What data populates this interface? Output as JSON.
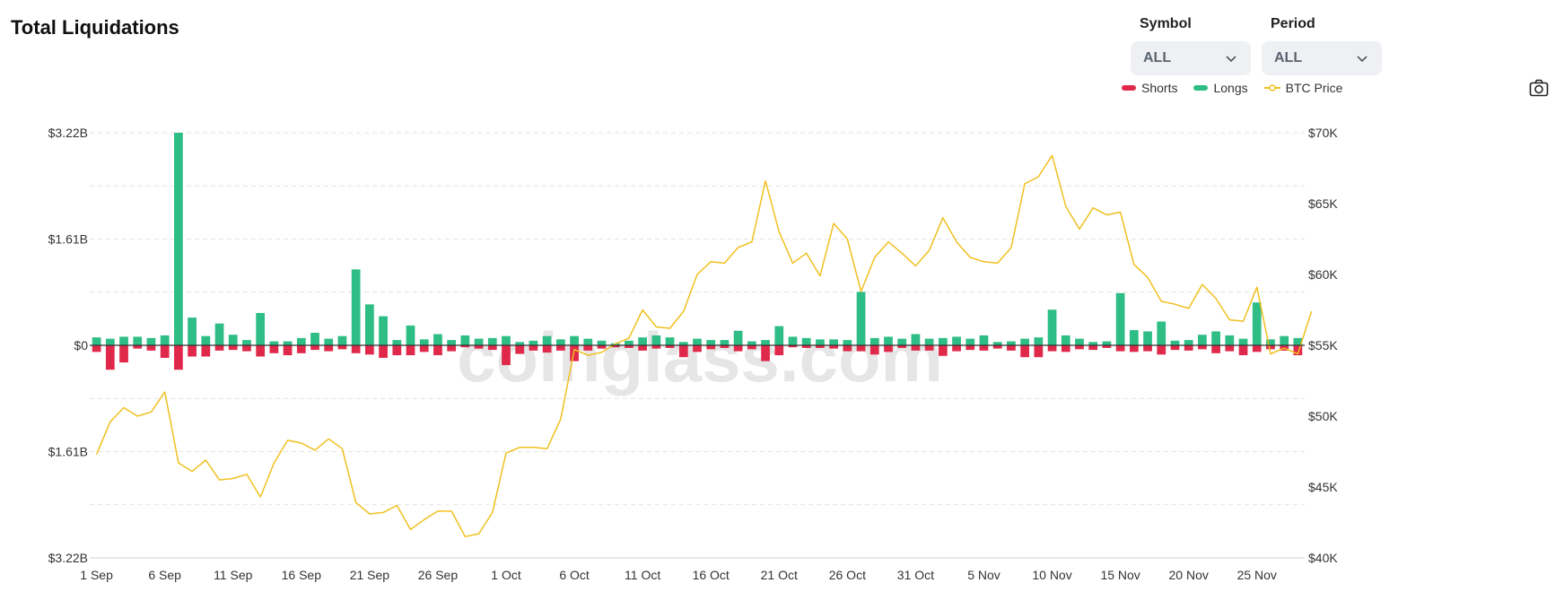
{
  "header": {
    "title": "Total Liquidations"
  },
  "controls": {
    "symbol_label": "Symbol",
    "symbol_value": "ALL",
    "period_label": "Period",
    "period_value": "ALL"
  },
  "legend": [
    {
      "name": "Shorts",
      "color": "#e0294a"
    },
    {
      "name": "Longs",
      "color": "#2dbd85"
    },
    {
      "name": "BTC Price",
      "color": "#f0c020"
    }
  ],
  "watermark": "coinglass.com",
  "icons": {
    "camera": "camera-icon",
    "chevron": "chevron-down-icon"
  },
  "chart_data": {
    "type": "bar",
    "title": "Total Liquidations",
    "x_tick_labels": [
      "1 Sep",
      "6 Sep",
      "11 Sep",
      "16 Sep",
      "21 Sep",
      "26 Sep",
      "1 Oct",
      "6 Oct",
      "11 Oct",
      "16 Oct",
      "21 Oct",
      "26 Oct",
      "31 Oct",
      "5 Nov",
      "10 Nov",
      "15 Nov",
      "20 Nov",
      "25 Nov"
    ],
    "left_axis_labels": [
      "$3.22B",
      "$1.61B",
      "$0",
      "$1.61B",
      "$3.22B"
    ],
    "left_axis_values": [
      3.22,
      1.61,
      0,
      -1.61,
      -3.22
    ],
    "right_axis_labels": [
      "$70K",
      "$65K",
      "$60K",
      "$55K",
      "$50K",
      "$45K",
      "$40K"
    ],
    "right_axis_values": [
      70000,
      65000,
      60000,
      55000,
      50000,
      45000,
      40000
    ],
    "ylim_left": [
      -3.22,
      3.22
    ],
    "ylim_right": [
      40000,
      70000
    ],
    "grid": true,
    "legend_position": "top-right",
    "series": [
      {
        "name": "Longs",
        "type": "bar",
        "color": "#2dbd85",
        "unit": "$B",
        "values": [
          0.12,
          0.1,
          0.13,
          0.13,
          0.11,
          0.15,
          3.22,
          0.42,
          0.14,
          0.33,
          0.16,
          0.08,
          0.49,
          0.06,
          0.06,
          0.11,
          0.19,
          0.1,
          0.14,
          1.15,
          0.62,
          0.44,
          0.08,
          0.3,
          0.09,
          0.17,
          0.08,
          0.15,
          0.1,
          0.11,
          0.14,
          0.05,
          0.07,
          0.14,
          0.09,
          0.14,
          0.1,
          0.07,
          0.03,
          0.07,
          0.12,
          0.15,
          0.12,
          0.05,
          0.1,
          0.08,
          0.08,
          0.22,
          0.06,
          0.08,
          0.29,
          0.13,
          0.11,
          0.09,
          0.09,
          0.08,
          0.81,
          0.11,
          0.13,
          0.1,
          0.17,
          0.1,
          0.11,
          0.13,
          0.1,
          0.15,
          0.05,
          0.06,
          0.1,
          0.12,
          0.54,
          0.15,
          0.1,
          0.05,
          0.06,
          0.79,
          0.23,
          0.21,
          0.36,
          0.07,
          0.08,
          0.16,
          0.21,
          0.15,
          0.1,
          0.65,
          0.09,
          0.14,
          0.11
        ]
      },
      {
        "name": "Shorts",
        "type": "bar",
        "color": "#e0294a",
        "unit": "$B",
        "values": [
          -0.1,
          -0.37,
          -0.26,
          -0.05,
          -0.08,
          -0.19,
          -0.37,
          -0.17,
          -0.17,
          -0.08,
          -0.07,
          -0.09,
          -0.17,
          -0.12,
          -0.15,
          -0.12,
          -0.07,
          -0.09,
          -0.06,
          -0.12,
          -0.14,
          -0.19,
          -0.15,
          -0.15,
          -0.1,
          -0.15,
          -0.09,
          -0.03,
          -0.05,
          -0.07,
          -0.3,
          -0.13,
          -0.08,
          -0.11,
          -0.08,
          -0.24,
          -0.08,
          -0.05,
          -0.03,
          -0.04,
          -0.08,
          -0.05,
          -0.04,
          -0.18,
          -0.1,
          -0.06,
          -0.04,
          -0.09,
          -0.06,
          -0.24,
          -0.15,
          -0.03,
          -0.04,
          -0.04,
          -0.05,
          -0.09,
          -0.09,
          -0.14,
          -0.1,
          -0.04,
          -0.08,
          -0.08,
          -0.16,
          -0.09,
          -0.07,
          -0.08,
          -0.05,
          -0.08,
          -0.18,
          -0.18,
          -0.09,
          -0.1,
          -0.06,
          -0.07,
          -0.04,
          -0.09,
          -0.1,
          -0.09,
          -0.14,
          -0.07,
          -0.08,
          -0.06,
          -0.12,
          -0.09,
          -0.15,
          -0.1,
          -0.06,
          -0.08,
          -0.15
        ]
      },
      {
        "name": "BTC Price",
        "type": "line",
        "color": "#f0c020",
        "unit": "USD",
        "values": [
          47300,
          49600,
          50600,
          50000,
          50300,
          51700,
          46700,
          46100,
          46900,
          45500,
          45600,
          45900,
          44300,
          46700,
          48300,
          48100,
          47600,
          48400,
          47700,
          43900,
          43100,
          43200,
          43700,
          42000,
          42700,
          43300,
          43300,
          41500,
          41700,
          43200,
          47400,
          47800,
          47800,
          47700,
          49800,
          54700,
          54300,
          54500,
          55100,
          55500,
          57500,
          56300,
          56200,
          57400,
          60000,
          60900,
          60800,
          61900,
          62300,
          66600,
          63000,
          60800,
          61500,
          59900,
          63600,
          62500,
          58800,
          61200,
          62300,
          61500,
          60600,
          61700,
          64000,
          62300,
          61200,
          60900,
          60800,
          61900,
          66400,
          66900,
          68400,
          64800,
          63200,
          64700,
          64200,
          64400,
          60700,
          59800,
          58100,
          57900,
          57600,
          59300,
          58300,
          56800,
          56700,
          59100,
          54400,
          54800,
          54400,
          57400
        ]
      }
    ]
  }
}
